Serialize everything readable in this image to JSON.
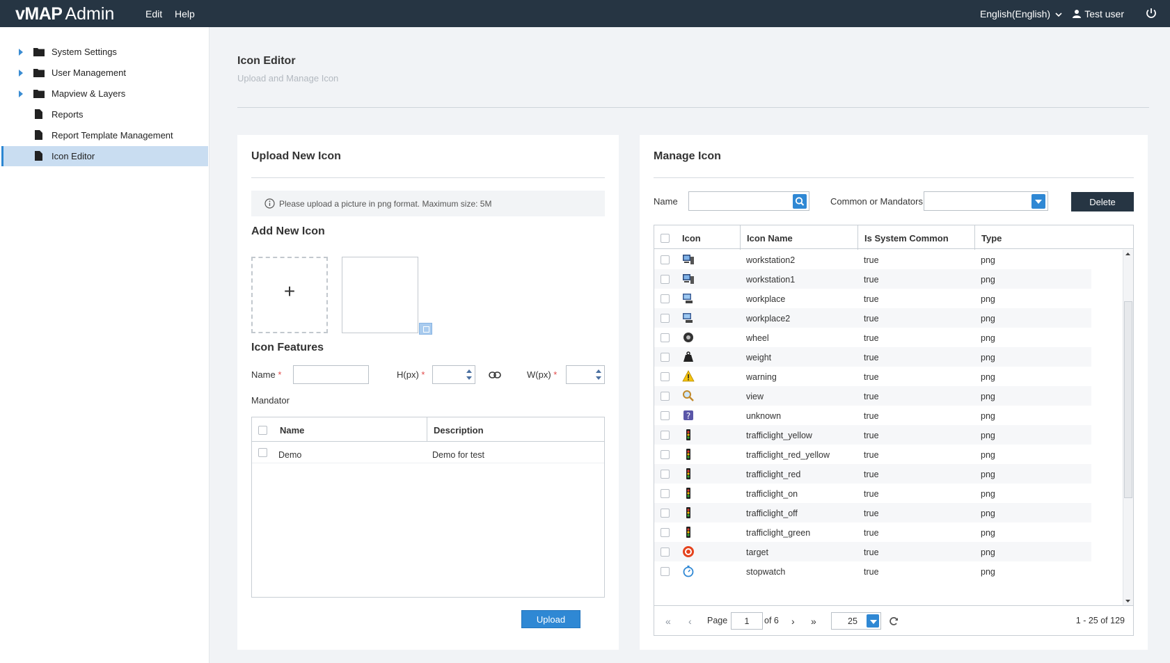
{
  "app": {
    "brand_bold": "vMAP",
    "brand_light": "Admin"
  },
  "topbar": {
    "menu": [
      "Edit",
      "Help"
    ],
    "language": "English(English)",
    "user": "Test user"
  },
  "sidebar": {
    "items": [
      {
        "label": "System Settings",
        "type": "folder",
        "expandable": true
      },
      {
        "label": "User Management",
        "type": "folder",
        "expandable": true
      },
      {
        "label": "Mapview & Layers",
        "type": "folder",
        "expandable": true
      },
      {
        "label": "Reports",
        "type": "file",
        "expandable": false
      },
      {
        "label": "Report Template Management",
        "type": "file",
        "expandable": false
      },
      {
        "label": "Icon Editor",
        "type": "file",
        "expandable": false,
        "active": true
      }
    ]
  },
  "page": {
    "title": "Icon Editor",
    "subtitle": "Upload and Manage Icon"
  },
  "upload": {
    "title": "Upload New Icon",
    "info": "Please upload a picture in png format. Maximum size: 5M",
    "add_title": "Add New Icon",
    "add_symbol": "+",
    "features_title": "Icon Features",
    "name_label": "Name",
    "h_label": "H(px)",
    "w_label": "W(px)",
    "required_mark": "*",
    "mandator_label": "Mandator",
    "mandator_grid": {
      "columns": [
        "Name",
        "Description"
      ],
      "rows": [
        {
          "name": "Demo",
          "description": "Demo for test"
        }
      ]
    },
    "upload_button": "Upload"
  },
  "manage": {
    "title": "Manage Icon",
    "name_label": "Name",
    "common_label": "Common or Mandators",
    "delete_button": "Delete",
    "columns": [
      "Icon",
      "Icon Name",
      "Is System Common",
      "Type"
    ],
    "rows": [
      {
        "icon": "workstation-icon",
        "name": "workstation2",
        "common": "true",
        "type": "png"
      },
      {
        "icon": "workstation-icon",
        "name": "workstation1",
        "common": "true",
        "type": "png"
      },
      {
        "icon": "computer-icon",
        "name": "workplace",
        "common": "true",
        "type": "png"
      },
      {
        "icon": "computer-icon",
        "name": "workplace2",
        "common": "true",
        "type": "png"
      },
      {
        "icon": "wheel-icon",
        "name": "wheel",
        "common": "true",
        "type": "png"
      },
      {
        "icon": "weight-icon",
        "name": "weight",
        "common": "true",
        "type": "png"
      },
      {
        "icon": "warning-icon",
        "name": "warning",
        "common": "true",
        "type": "png"
      },
      {
        "icon": "magnifier-icon",
        "name": "view",
        "common": "true",
        "type": "png"
      },
      {
        "icon": "question-icon",
        "name": "unknown",
        "common": "true",
        "type": "png"
      },
      {
        "icon": "trafficlight-icon",
        "name": "trafficlight_yellow",
        "common": "true",
        "type": "png"
      },
      {
        "icon": "trafficlight-icon",
        "name": "trafficlight_red_yellow",
        "common": "true",
        "type": "png"
      },
      {
        "icon": "trafficlight-icon",
        "name": "trafficlight_red",
        "common": "true",
        "type": "png"
      },
      {
        "icon": "trafficlight-icon",
        "name": "trafficlight_on",
        "common": "true",
        "type": "png"
      },
      {
        "icon": "trafficlight-icon",
        "name": "trafficlight_off",
        "common": "true",
        "type": "png"
      },
      {
        "icon": "trafficlight-icon",
        "name": "trafficlight_green",
        "common": "true",
        "type": "png"
      },
      {
        "icon": "target-icon",
        "name": "target",
        "common": "true",
        "type": "png"
      },
      {
        "icon": "stopwatch-icon",
        "name": "stopwatch",
        "common": "true",
        "type": "png"
      }
    ],
    "pager": {
      "page_label": "Page",
      "page": "1",
      "of_label": "of 6",
      "page_size": "25",
      "summary": "1 - 25 of 129"
    }
  },
  "colors": {
    "topbar": "#263543",
    "accent": "#2f88d4",
    "active_nav": "#c9ddf1",
    "background": "#f1f3f6"
  }
}
